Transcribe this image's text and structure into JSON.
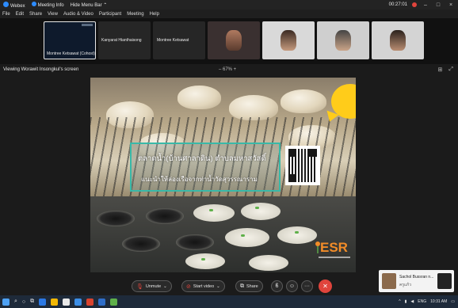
{
  "titlebar": {
    "app": "Webex",
    "meeting_info": "Meeting Info",
    "hide_menu": "Hide Menu Bar ⌃",
    "timer": "00:27:01"
  },
  "menu": [
    "File",
    "Edit",
    "Share",
    "View",
    "Audio & Video",
    "Participant",
    "Meeting",
    "Help"
  ],
  "participants": [
    {
      "name": "Montree Ketsawat (Cohost)",
      "active": true
    },
    {
      "name": "Kanyarat Hianthaisong",
      "active": false
    },
    {
      "name": "Montree Ketsawat",
      "active": false
    }
  ],
  "viewing": {
    "label": "Viewing Worawit Insongkul's screen",
    "zoom": "–  67%  +"
  },
  "slide": {
    "line1": "ตลาดน้ำ(บ้านศาลาดิน) ตำบลมหาสวัสดิ์",
    "line2": "แนะนำให้ล่องเรือจากท่าน้ำวัดสุวรรณาราม",
    "logo": "ESR"
  },
  "controls": {
    "unmute": "Unmute",
    "start_video": "Start video",
    "share": "Share",
    "more": "···"
  },
  "notification": {
    "name": "Sachol Bussran n...",
    "message": "ครูแก้ว"
  },
  "tray": {
    "lang": "ENG",
    "time": "10:31 AM"
  },
  "colors": {
    "accent": "#2d8cff",
    "leave": "#e0443c",
    "frame": "#39b9a8",
    "logo": "#f28c28"
  }
}
